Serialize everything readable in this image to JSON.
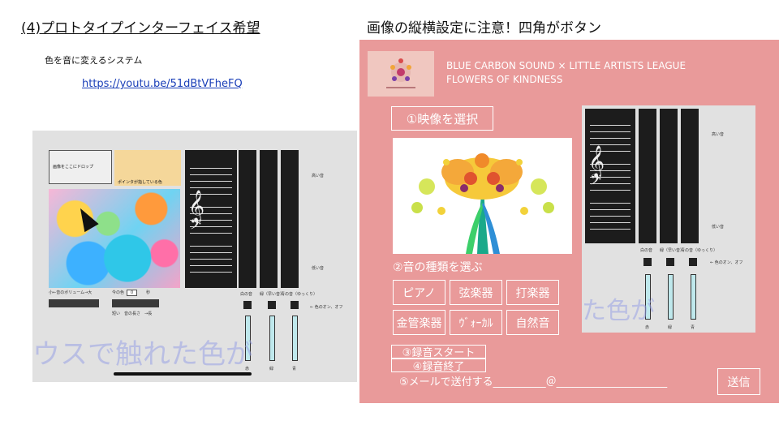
{
  "left": {
    "title": "(4)プロトタイプインターフェイス希望",
    "description": "色を音に変えるシステム",
    "link": "https://youtu.be/51dBtVFheFQ",
    "screenshot": {
      "drop_text": "画像をここにドロップ",
      "pointer_color_text": "ポインタが指している色",
      "volume_label": "小←音のボリューム→大",
      "duration_label": "今の色",
      "duration_value": "0",
      "duration_unit": "秒",
      "length_label": "短い　音の長さ　→長",
      "high_label": "高い音",
      "low_label": "低い音",
      "color_onoff_label": "← 色のオン、オフ",
      "col_labels": [
        "白の音",
        "緑（早い音）",
        "青の音（ゆっくり）"
      ],
      "bottom_labels": [
        "赤",
        "緑",
        "青"
      ],
      "overlay_text": "ウスで触れた色が"
    }
  },
  "right": {
    "title": "画像の縦横設定に注意！四角がボタン",
    "banner_line1": "BLUE CARBON SOUND × LITTLE ARTISTS LEAGUE",
    "banner_line2": "FLOWERS OF KINDNESS",
    "select_video": "①映像を選択",
    "sound_type_label": "②音の種類を選ぶ",
    "instruments": [
      "ピアノ",
      "弦楽器",
      "打楽器",
      "金管楽器",
      "ｳﾞｫｰｶﾙ",
      "自然音"
    ],
    "record_start": "③録音スタート",
    "record_stop": "④録音終了",
    "mail_label": "⑤メールで送付する__________＠_____________________",
    "send": "送信",
    "screenshot": {
      "high_label": "高い音",
      "low_label": "低い音",
      "color_onoff_label": "← 色のオン、オフ",
      "col_labels": [
        "白の音",
        "緑（早い音）",
        "青の音（ゆっくり）"
      ],
      "bottom_labels": [
        "赤",
        "緑",
        "青"
      ],
      "overlay_text": "た色が"
    }
  },
  "colors": {
    "panel": "#e99a9a",
    "link": "#1a3fb8",
    "overlay": "#9aa2e6"
  }
}
